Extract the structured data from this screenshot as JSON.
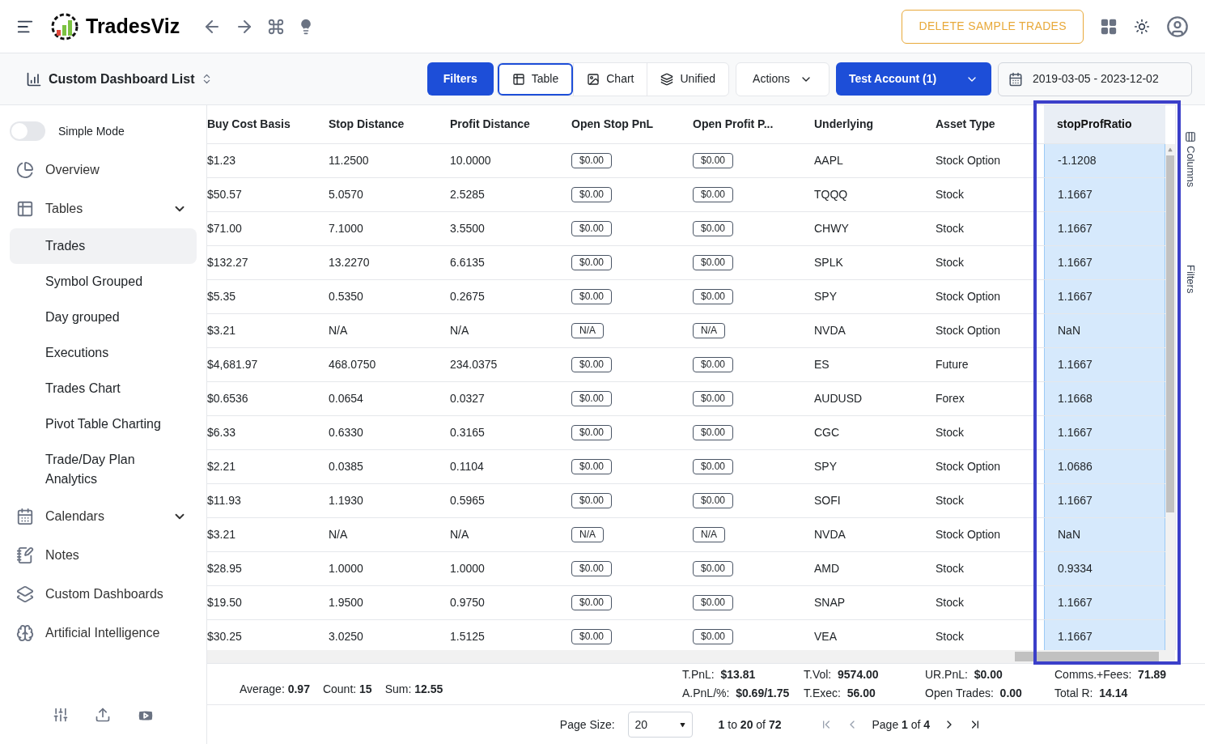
{
  "header": {
    "brand": "TradesViz",
    "delete_button": "DELETE SAMPLE TRADES"
  },
  "toolbar": {
    "dashboard_list": "Custom Dashboard List",
    "filters_button": "Filters",
    "views": [
      {
        "label": "Table",
        "selected": true
      },
      {
        "label": "Chart",
        "selected": false
      },
      {
        "label": "Unified",
        "selected": false
      }
    ],
    "actions": "Actions",
    "account": "Test Account (1)",
    "date_range": "2019-03-05 - 2023-12-02"
  },
  "sidebar": {
    "simple_mode": {
      "label": "Simple Mode",
      "on": false
    },
    "items": [
      {
        "label": "Overview"
      },
      {
        "label": "Tables",
        "collapsible": true,
        "children": [
          {
            "label": "Trades",
            "selected": true
          },
          {
            "label": "Symbol Grouped",
            "selected": false
          },
          {
            "label": "Day grouped",
            "selected": false
          },
          {
            "label": "Executions",
            "selected": false
          },
          {
            "label": "Trades Chart",
            "selected": false
          },
          {
            "label": "Pivot Table Charting",
            "selected": false
          },
          {
            "label": "Trade/Day Plan Analytics",
            "selected": false
          }
        ]
      },
      {
        "label": "Calendars",
        "collapsible": true
      },
      {
        "label": "Notes"
      },
      {
        "label": "Custom Dashboards"
      },
      {
        "label": "Artificial Intelligence"
      }
    ]
  },
  "table": {
    "columns": [
      {
        "label": "Buy Cost Basis",
        "kind": "text",
        "selected": false
      },
      {
        "label": "Stop Distance",
        "kind": "text",
        "selected": false
      },
      {
        "label": "Profit Distance",
        "kind": "text",
        "selected": false
      },
      {
        "label": "Open Stop PnL",
        "kind": "pill",
        "selected": false
      },
      {
        "label": "Open Profit P...",
        "kind": "pill",
        "selected": false
      },
      {
        "label": "Underlying",
        "kind": "text",
        "selected": false
      },
      {
        "label": "Asset Type",
        "kind": "text",
        "selected": false
      },
      {
        "label": "stopProfRatio",
        "kind": "text",
        "selected": true
      }
    ],
    "rows": [
      [
        "$1.23",
        "11.2500",
        "10.0000",
        "$0.00",
        "$0.00",
        "AAPL",
        "Stock Option",
        "-1.1208"
      ],
      [
        "$50.57",
        "5.0570",
        "2.5285",
        "$0.00",
        "$0.00",
        "TQQQ",
        "Stock",
        "1.1667"
      ],
      [
        "$71.00",
        "7.1000",
        "3.5500",
        "$0.00",
        "$0.00",
        "CHWY",
        "Stock",
        "1.1667"
      ],
      [
        "$132.27",
        "13.2270",
        "6.6135",
        "$0.00",
        "$0.00",
        "SPLK",
        "Stock",
        "1.1667"
      ],
      [
        "$5.35",
        "0.5350",
        "0.2675",
        "$0.00",
        "$0.00",
        "SPY",
        "Stock Option",
        "1.1667"
      ],
      [
        "$3.21",
        "N/A",
        "N/A",
        "N/A",
        "N/A",
        "NVDA",
        "Stock Option",
        "NaN"
      ],
      [
        "$4,681.97",
        "468.0750",
        "234.0375",
        "$0.00",
        "$0.00",
        "ES",
        "Future",
        "1.1667"
      ],
      [
        "$0.6536",
        "0.0654",
        "0.0327",
        "$0.00",
        "$0.00",
        "AUDUSD",
        "Forex",
        "1.1668"
      ],
      [
        "$6.33",
        "0.6330",
        "0.3165",
        "$0.00",
        "$0.00",
        "CGC",
        "Stock",
        "1.1667"
      ],
      [
        "$2.21",
        "0.0385",
        "0.1104",
        "$0.00",
        "$0.00",
        "SPY",
        "Stock Option",
        "1.0686"
      ],
      [
        "$11.93",
        "1.1930",
        "0.5965",
        "$0.00",
        "$0.00",
        "SOFI",
        "Stock",
        "1.1667"
      ],
      [
        "$3.21",
        "N/A",
        "N/A",
        "N/A",
        "N/A",
        "NVDA",
        "Stock Option",
        "NaN"
      ],
      [
        "$28.95",
        "1.0000",
        "1.0000",
        "$0.00",
        "$0.00",
        "AMD",
        "Stock",
        "0.9334"
      ],
      [
        "$19.50",
        "1.9500",
        "0.9750",
        "$0.00",
        "$0.00",
        "SNAP",
        "Stock",
        "1.1667"
      ],
      [
        "$30.25",
        "3.0250",
        "1.5125",
        "$0.00",
        "$0.00",
        "VEA",
        "Stock",
        "1.1667"
      ]
    ],
    "side_tabs": [
      "Columns",
      "Filters"
    ]
  },
  "summary": {
    "selection": [
      {
        "label": "Average:",
        "value": "0.97"
      },
      {
        "label": "Count:",
        "value": "15"
      },
      {
        "label": "Sum:",
        "value": "12.55"
      }
    ],
    "stats": [
      {
        "label": "T.PnL:",
        "value": "$13.81"
      },
      {
        "label": "T.Vol:",
        "value": "9574.00"
      },
      {
        "label": "UR.PnL:",
        "value": "$0.00"
      },
      {
        "label": "Comms.+Fees:",
        "value": "71.89"
      },
      {
        "label": "A.PnL/%:",
        "value": "$0.69/1.75"
      },
      {
        "label": "T.Exec:",
        "value": "56.00"
      },
      {
        "label": "Open Trades:",
        "value": "0.00"
      },
      {
        "label": "Total R:",
        "value": "14.14"
      }
    ]
  },
  "pagination": {
    "page_size_label": "Page Size:",
    "page_size": "20",
    "range": "**1** to **20** of **72**",
    "page": "Page **1** of **4**"
  }
}
